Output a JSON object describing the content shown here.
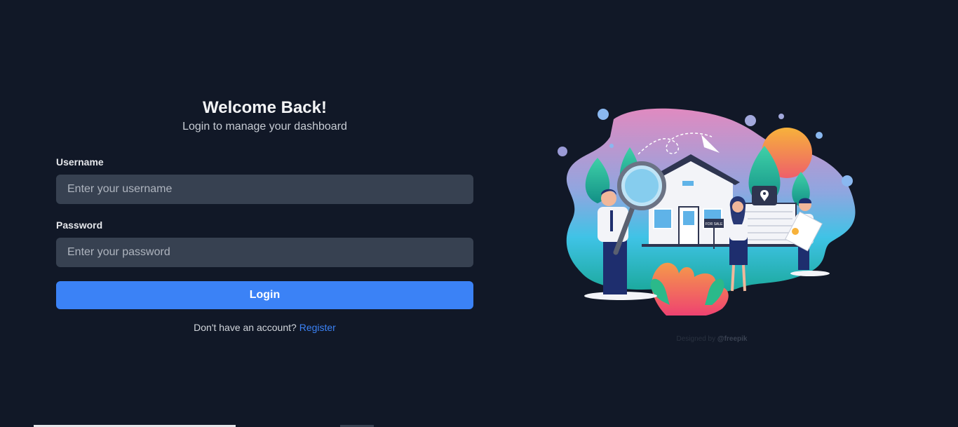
{
  "login": {
    "title": "Welcome Back!",
    "subtitle": "Login to manage your dashboard",
    "username_label": "Username",
    "username_placeholder": "Enter your username",
    "password_label": "Password",
    "password_placeholder": "Enter your password",
    "login_button": "Login",
    "register_prompt": "Don't have an account?",
    "register_link": "Register"
  },
  "illustration": {
    "sign_text": "FOR SALE",
    "credit_prefix": "Designed by",
    "credit_brand": "@freepik"
  },
  "colors": {
    "background": "#111827",
    "input_bg": "#374151",
    "accent": "#3b82f6"
  }
}
